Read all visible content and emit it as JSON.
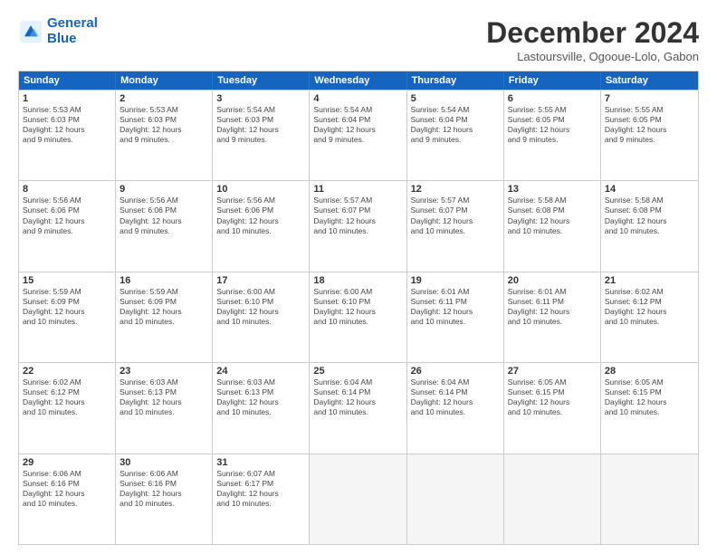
{
  "logo": {
    "line1": "General",
    "line2": "Blue"
  },
  "header": {
    "month": "December 2024",
    "location": "Lastoursville, Ogooue-Lolo, Gabon"
  },
  "days": [
    "Sunday",
    "Monday",
    "Tuesday",
    "Wednesday",
    "Thursday",
    "Friday",
    "Saturday"
  ],
  "weeks": [
    [
      {
        "day": "1",
        "lines": [
          "Sunrise: 5:53 AM",
          "Sunset: 6:03 PM",
          "Daylight: 12 hours",
          "and 9 minutes."
        ]
      },
      {
        "day": "2",
        "lines": [
          "Sunrise: 5:53 AM",
          "Sunset: 6:03 PM",
          "Daylight: 12 hours",
          "and 9 minutes."
        ]
      },
      {
        "day": "3",
        "lines": [
          "Sunrise: 5:54 AM",
          "Sunset: 6:03 PM",
          "Daylight: 12 hours",
          "and 9 minutes."
        ]
      },
      {
        "day": "4",
        "lines": [
          "Sunrise: 5:54 AM",
          "Sunset: 6:04 PM",
          "Daylight: 12 hours",
          "and 9 minutes."
        ]
      },
      {
        "day": "5",
        "lines": [
          "Sunrise: 5:54 AM",
          "Sunset: 6:04 PM",
          "Daylight: 12 hours",
          "and 9 minutes."
        ]
      },
      {
        "day": "6",
        "lines": [
          "Sunrise: 5:55 AM",
          "Sunset: 6:05 PM",
          "Daylight: 12 hours",
          "and 9 minutes."
        ]
      },
      {
        "day": "7",
        "lines": [
          "Sunrise: 5:55 AM",
          "Sunset: 6:05 PM",
          "Daylight: 12 hours",
          "and 9 minutes."
        ]
      }
    ],
    [
      {
        "day": "8",
        "lines": [
          "Sunrise: 5:56 AM",
          "Sunset: 6:06 PM",
          "Daylight: 12 hours",
          "and 9 minutes."
        ]
      },
      {
        "day": "9",
        "lines": [
          "Sunrise: 5:56 AM",
          "Sunset: 6:06 PM",
          "Daylight: 12 hours",
          "and 9 minutes."
        ]
      },
      {
        "day": "10",
        "lines": [
          "Sunrise: 5:56 AM",
          "Sunset: 6:06 PM",
          "Daylight: 12 hours",
          "and 10 minutes."
        ]
      },
      {
        "day": "11",
        "lines": [
          "Sunrise: 5:57 AM",
          "Sunset: 6:07 PM",
          "Daylight: 12 hours",
          "and 10 minutes."
        ]
      },
      {
        "day": "12",
        "lines": [
          "Sunrise: 5:57 AM",
          "Sunset: 6:07 PM",
          "Daylight: 12 hours",
          "and 10 minutes."
        ]
      },
      {
        "day": "13",
        "lines": [
          "Sunrise: 5:58 AM",
          "Sunset: 6:08 PM",
          "Daylight: 12 hours",
          "and 10 minutes."
        ]
      },
      {
        "day": "14",
        "lines": [
          "Sunrise: 5:58 AM",
          "Sunset: 6:08 PM",
          "Daylight: 12 hours",
          "and 10 minutes."
        ]
      }
    ],
    [
      {
        "day": "15",
        "lines": [
          "Sunrise: 5:59 AM",
          "Sunset: 6:09 PM",
          "Daylight: 12 hours",
          "and 10 minutes."
        ]
      },
      {
        "day": "16",
        "lines": [
          "Sunrise: 5:59 AM",
          "Sunset: 6:09 PM",
          "Daylight: 12 hours",
          "and 10 minutes."
        ]
      },
      {
        "day": "17",
        "lines": [
          "Sunrise: 6:00 AM",
          "Sunset: 6:10 PM",
          "Daylight: 12 hours",
          "and 10 minutes."
        ]
      },
      {
        "day": "18",
        "lines": [
          "Sunrise: 6:00 AM",
          "Sunset: 6:10 PM",
          "Daylight: 12 hours",
          "and 10 minutes."
        ]
      },
      {
        "day": "19",
        "lines": [
          "Sunrise: 6:01 AM",
          "Sunset: 6:11 PM",
          "Daylight: 12 hours",
          "and 10 minutes."
        ]
      },
      {
        "day": "20",
        "lines": [
          "Sunrise: 6:01 AM",
          "Sunset: 6:11 PM",
          "Daylight: 12 hours",
          "and 10 minutes."
        ]
      },
      {
        "day": "21",
        "lines": [
          "Sunrise: 6:02 AM",
          "Sunset: 6:12 PM",
          "Daylight: 12 hours",
          "and 10 minutes."
        ]
      }
    ],
    [
      {
        "day": "22",
        "lines": [
          "Sunrise: 6:02 AM",
          "Sunset: 6:12 PM",
          "Daylight: 12 hours",
          "and 10 minutes."
        ]
      },
      {
        "day": "23",
        "lines": [
          "Sunrise: 6:03 AM",
          "Sunset: 6:13 PM",
          "Daylight: 12 hours",
          "and 10 minutes."
        ]
      },
      {
        "day": "24",
        "lines": [
          "Sunrise: 6:03 AM",
          "Sunset: 6:13 PM",
          "Daylight: 12 hours",
          "and 10 minutes."
        ]
      },
      {
        "day": "25",
        "lines": [
          "Sunrise: 6:04 AM",
          "Sunset: 6:14 PM",
          "Daylight: 12 hours",
          "and 10 minutes."
        ]
      },
      {
        "day": "26",
        "lines": [
          "Sunrise: 6:04 AM",
          "Sunset: 6:14 PM",
          "Daylight: 12 hours",
          "and 10 minutes."
        ]
      },
      {
        "day": "27",
        "lines": [
          "Sunrise: 6:05 AM",
          "Sunset: 6:15 PM",
          "Daylight: 12 hours",
          "and 10 minutes."
        ]
      },
      {
        "day": "28",
        "lines": [
          "Sunrise: 6:05 AM",
          "Sunset: 6:15 PM",
          "Daylight: 12 hours",
          "and 10 minutes."
        ]
      }
    ],
    [
      {
        "day": "29",
        "lines": [
          "Sunrise: 6:06 AM",
          "Sunset: 6:16 PM",
          "Daylight: 12 hours",
          "and 10 minutes."
        ]
      },
      {
        "day": "30",
        "lines": [
          "Sunrise: 6:06 AM",
          "Sunset: 6:16 PM",
          "Daylight: 12 hours",
          "and 10 minutes."
        ]
      },
      {
        "day": "31",
        "lines": [
          "Sunrise: 6:07 AM",
          "Sunset: 6:17 PM",
          "Daylight: 12 hours",
          "and 10 minutes."
        ]
      },
      null,
      null,
      null,
      null
    ]
  ]
}
